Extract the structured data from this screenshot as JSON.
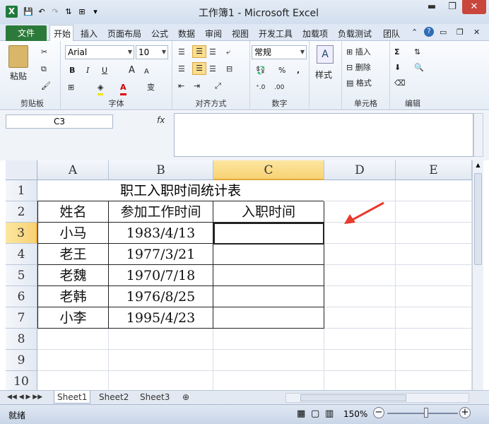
{
  "window": {
    "title": "工作簿1 - Microsoft Excel",
    "min": "▬",
    "restore": "❐",
    "close": "✕"
  },
  "menu": {
    "file": "文件",
    "tabs": [
      "开始",
      "插入",
      "页面布局",
      "公式",
      "数据",
      "审阅",
      "视图",
      "开发工具",
      "加载项",
      "负载测试",
      "团队"
    ]
  },
  "ribbon": {
    "clipboard": {
      "label": "剪贴板",
      "paste": "粘贴"
    },
    "font": {
      "label": "字体",
      "name": "Arial",
      "size": "10",
      "bold": "B",
      "italic": "I",
      "underline": "U",
      "grow": "A",
      "shrink": "A",
      "wen": "变"
    },
    "align": {
      "label": "对齐方式"
    },
    "number": {
      "label": "数字",
      "format": "常规",
      "percent": "%",
      "comma": ","
    },
    "styles": {
      "label": "样式"
    },
    "cells": {
      "label": "单元格",
      "insert": "插入",
      "delete": "删除",
      "format": "格式"
    },
    "edit": {
      "label": "编辑",
      "sum": "Σ"
    }
  },
  "formula": {
    "namebox": "C3",
    "fx": "fx",
    "value": ""
  },
  "columns": [
    "A",
    "B",
    "C",
    "D",
    "E"
  ],
  "rows": [
    "1",
    "2",
    "3",
    "4",
    "5",
    "6",
    "7",
    "8",
    "9",
    "10"
  ],
  "sheet": {
    "title": "职工入职时间统计表",
    "headers": [
      "姓名",
      "参加工作时间",
      "入职时间"
    ],
    "data": [
      [
        "小马",
        "1983/4/13",
        ""
      ],
      [
        "老王",
        "1977/3/21",
        ""
      ],
      [
        "老魏",
        "1970/7/18",
        ""
      ],
      [
        "老韩",
        "1976/8/25",
        ""
      ],
      [
        "小李",
        "1995/4/23",
        ""
      ]
    ]
  },
  "tabs": [
    "Sheet1",
    "Sheet2",
    "Sheet3"
  ],
  "status": {
    "ready": "就绪",
    "zoom": "150%",
    "minus": "−",
    "plus": "+"
  },
  "colors": {
    "accent": "#2c7a3a",
    "selection": "#f8d273",
    "arrow": "#e8392d"
  }
}
